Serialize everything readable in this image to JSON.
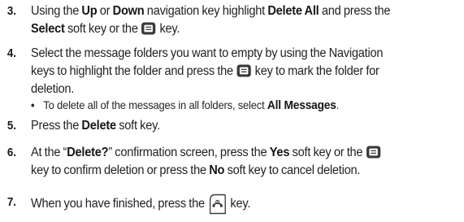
{
  "steps": [
    {
      "number": "3.",
      "lines": [
        [
          "Using the ",
          "Up",
          " or ",
          "Down",
          " navigation key highlight ",
          "Delete All",
          " and press the"
        ],
        [
          "Select",
          " soft key or the ",
          "",
          " key."
        ]
      ]
    },
    {
      "number": "4.",
      "lines": [
        [
          "Select the message folders you want to empty by using the Navigation"
        ],
        [
          "keys to highlight the folder and press the ",
          "",
          " key to mark the folder for"
        ],
        [
          "deletion."
        ]
      ],
      "bullet": [
        "To delete all of the messages in all folders, select ",
        "All Messages",
        "."
      ]
    },
    {
      "number": "5.",
      "lines": [
        [
          "Press the ",
          "Delete",
          " soft key."
        ]
      ]
    },
    {
      "number": "6.",
      "lines": [
        [
          "At the “",
          "Delete?",
          "” confirmation screen, press the ",
          "Yes",
          " soft key or the ",
          ""
        ],
        [
          "key to confirm deletion or press the ",
          "No",
          " soft key to cancel deletion."
        ]
      ]
    },
    {
      "number": "7.",
      "lines": [
        [
          "When you have finished, press the ",
          "",
          " key."
        ]
      ]
    }
  ],
  "icons": {
    "ok_key": "menu-ok-key-icon",
    "end_key": "end-power-key-icon"
  },
  "colors": {
    "text": "#222222",
    "icon_fill": "#3a3a3a"
  }
}
